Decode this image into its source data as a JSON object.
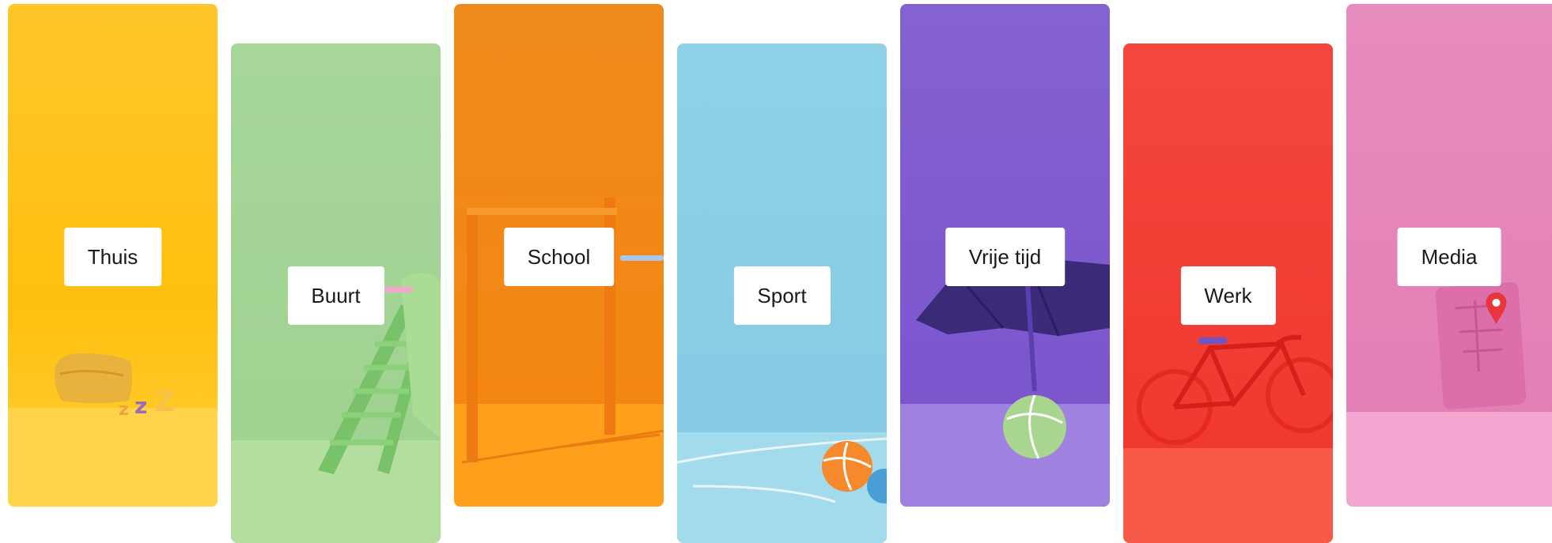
{
  "categories": [
    {
      "label": "Thuis",
      "color": "#ffc62a"
    },
    {
      "label": "Buurt",
      "color": "#a6d69a"
    },
    {
      "label": "School",
      "color": "#ee8a1c"
    },
    {
      "label": "Sport",
      "color": "#8fd1e6"
    },
    {
      "label": "Vrije tijd",
      "color": "#8462d0"
    },
    {
      "label": "Werk",
      "color": "#f3473d"
    },
    {
      "label": "Media",
      "color": "#e68cbd"
    }
  ],
  "illustrations": [
    "pillow-with-zzz",
    "slide",
    "pull-up-bar",
    "balls",
    "umbrella-and-ball",
    "bicycle",
    "phone-with-map-pin"
  ]
}
